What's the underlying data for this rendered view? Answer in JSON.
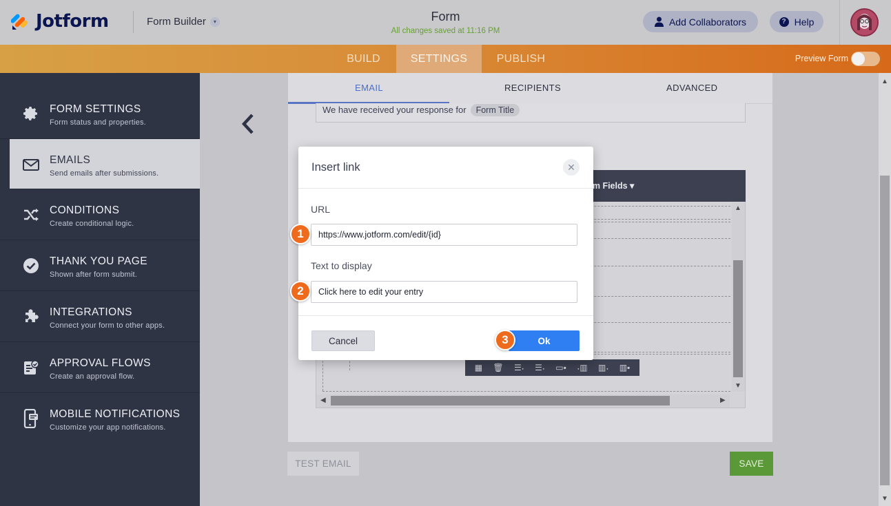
{
  "header": {
    "logo_text": "Jotform",
    "builder_label": "Form Builder",
    "form_title": "Form",
    "saved_status": "All changes saved at 11:16 PM",
    "collaborators_label": "Add Collaborators",
    "help_label": "Help"
  },
  "nav": {
    "tabs": [
      {
        "label": "BUILD"
      },
      {
        "label": "SETTINGS"
      },
      {
        "label": "PUBLISH"
      }
    ],
    "active_tab": "SETTINGS",
    "preview_label": "Preview Form",
    "preview_on": false
  },
  "sidebar": {
    "items": [
      {
        "title": "FORM SETTINGS",
        "subtitle": "Form status and properties.",
        "icon": "gear-icon"
      },
      {
        "title": "EMAILS",
        "subtitle": "Send emails after submissions.",
        "icon": "envelope-icon"
      },
      {
        "title": "CONDITIONS",
        "subtitle": "Create conditional logic.",
        "icon": "shuffle-icon"
      },
      {
        "title": "THANK YOU PAGE",
        "subtitle": "Shown after form submit.",
        "icon": "check-circle-icon"
      },
      {
        "title": "INTEGRATIONS",
        "subtitle": "Connect your form to other apps.",
        "icon": "puzzle-icon"
      },
      {
        "title": "APPROVAL FLOWS",
        "subtitle": "Create an approval flow.",
        "icon": "approval-icon"
      },
      {
        "title": "MOBILE NOTIFICATIONS",
        "subtitle": "Customize your app notifications.",
        "icon": "mobile-icon"
      }
    ],
    "active_item": "EMAILS"
  },
  "email_editor": {
    "tabs": [
      {
        "label": "EMAIL"
      },
      {
        "label": "RECIPIENTS"
      },
      {
        "label": "ADVANCED"
      }
    ],
    "active_tab": "EMAIL",
    "subject_text": "We have received your response for",
    "subject_chip": "Form Title",
    "form_fields_label": "rm Fields ▾",
    "test_email_label": "TEST EMAIL",
    "save_label": "SAVE"
  },
  "modal": {
    "title": "Insert link",
    "url_label": "URL",
    "url_value": "https://www.jotform.com/edit/{id}",
    "text_label": "Text to display",
    "text_value": "Click here to edit your entry",
    "cancel_label": "Cancel",
    "ok_label": "Ok"
  },
  "annotations": {
    "step1": "1",
    "step2": "2",
    "step3": "3"
  },
  "colors": {
    "brand_navy": "#0a1551",
    "nav_orange": "#d98c38",
    "sidebar_dark": "#2f3445",
    "ok_blue": "#2f7ff3",
    "save_green": "#5a9838",
    "badge_orange": "#ee6a1d"
  }
}
